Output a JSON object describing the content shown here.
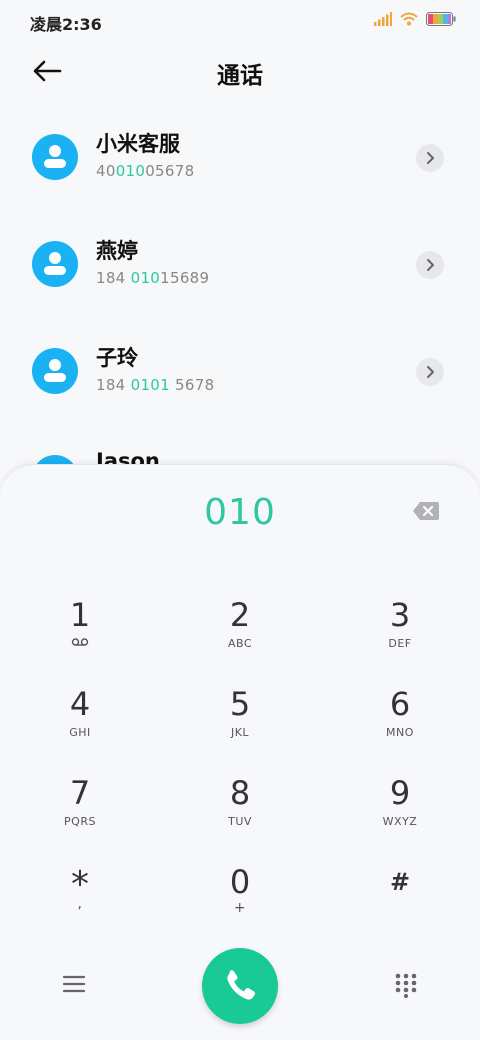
{
  "status_bar": {
    "time": "凌晨2:36"
  },
  "header": {
    "title": "通话"
  },
  "contacts": [
    {
      "name": "小米客服",
      "number_parts": [
        "40",
        "010",
        "05678"
      ]
    },
    {
      "name": "燕婷",
      "number_parts": [
        "184 ",
        "010",
        "15689"
      ]
    },
    {
      "name": "子玲",
      "number_parts": [
        "184 ",
        "0101",
        " 5678"
      ]
    },
    {
      "name": "Jason",
      "number_parts": [
        "",
        "",
        ""
      ]
    }
  ],
  "dialpad": {
    "input": "010",
    "keys": [
      {
        "digit": "1",
        "letters": ""
      },
      {
        "digit": "2",
        "letters": "ABC"
      },
      {
        "digit": "3",
        "letters": "DEF"
      },
      {
        "digit": "4",
        "letters": "GHI"
      },
      {
        "digit": "5",
        "letters": "JKL"
      },
      {
        "digit": "6",
        "letters": "MNO"
      },
      {
        "digit": "7",
        "letters": "PQRS"
      },
      {
        "digit": "8",
        "letters": "TUV"
      },
      {
        "digit": "9",
        "letters": "WXYZ"
      },
      {
        "digit": "*",
        "letters": ","
      },
      {
        "digit": "0",
        "letters": "+"
      },
      {
        "digit": "#",
        "letters": ""
      }
    ]
  },
  "icons": {
    "back": "arrow-left-icon",
    "chevron": "chevron-right-icon",
    "backspace": "backspace-icon",
    "voicemail": "voicemail-icon",
    "menu": "menu-icon",
    "call": "phone-icon",
    "keypad": "keypad-icon"
  },
  "colors": {
    "accent": "#2ec7a0",
    "call": "#19c996",
    "avatar": "#1ab2f3"
  }
}
